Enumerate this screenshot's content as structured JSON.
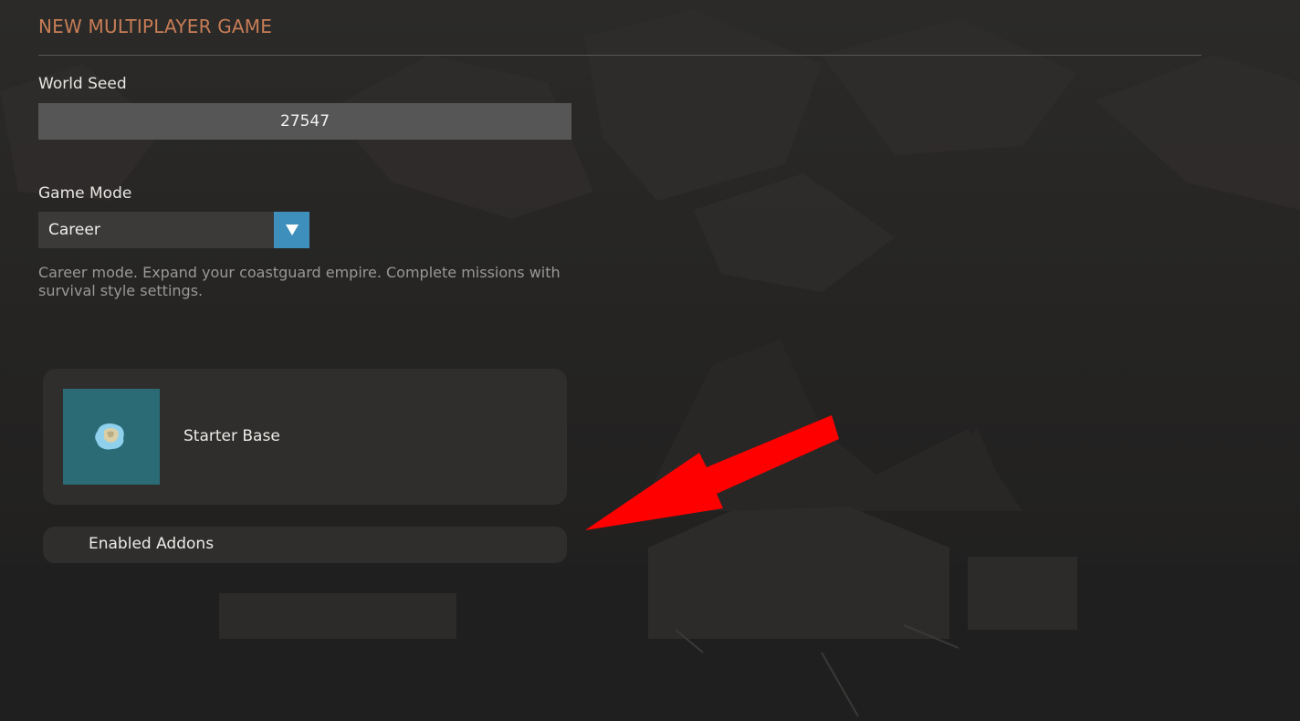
{
  "menu": {
    "title": "NEW MULTIPLAYER GAME",
    "accent_color": "#c77d56"
  },
  "world_seed": {
    "label": "World Seed",
    "value": "27547"
  },
  "game_mode": {
    "label": "Game Mode",
    "selected": "Career",
    "arrow_icon": "triangle-down-icon",
    "arrow_color": "#3f8fbd",
    "description": "Career mode. Expand your coastguard empire. Complete missions with survival style settings."
  },
  "starter_base": {
    "label": "Starter Base",
    "icon": "island-icon",
    "thumbnail_color": "#2a6b76"
  },
  "addons": {
    "label": "Enabled Addons"
  },
  "annotation": {
    "icon": "arrow-icon",
    "color": "#ff0000"
  }
}
